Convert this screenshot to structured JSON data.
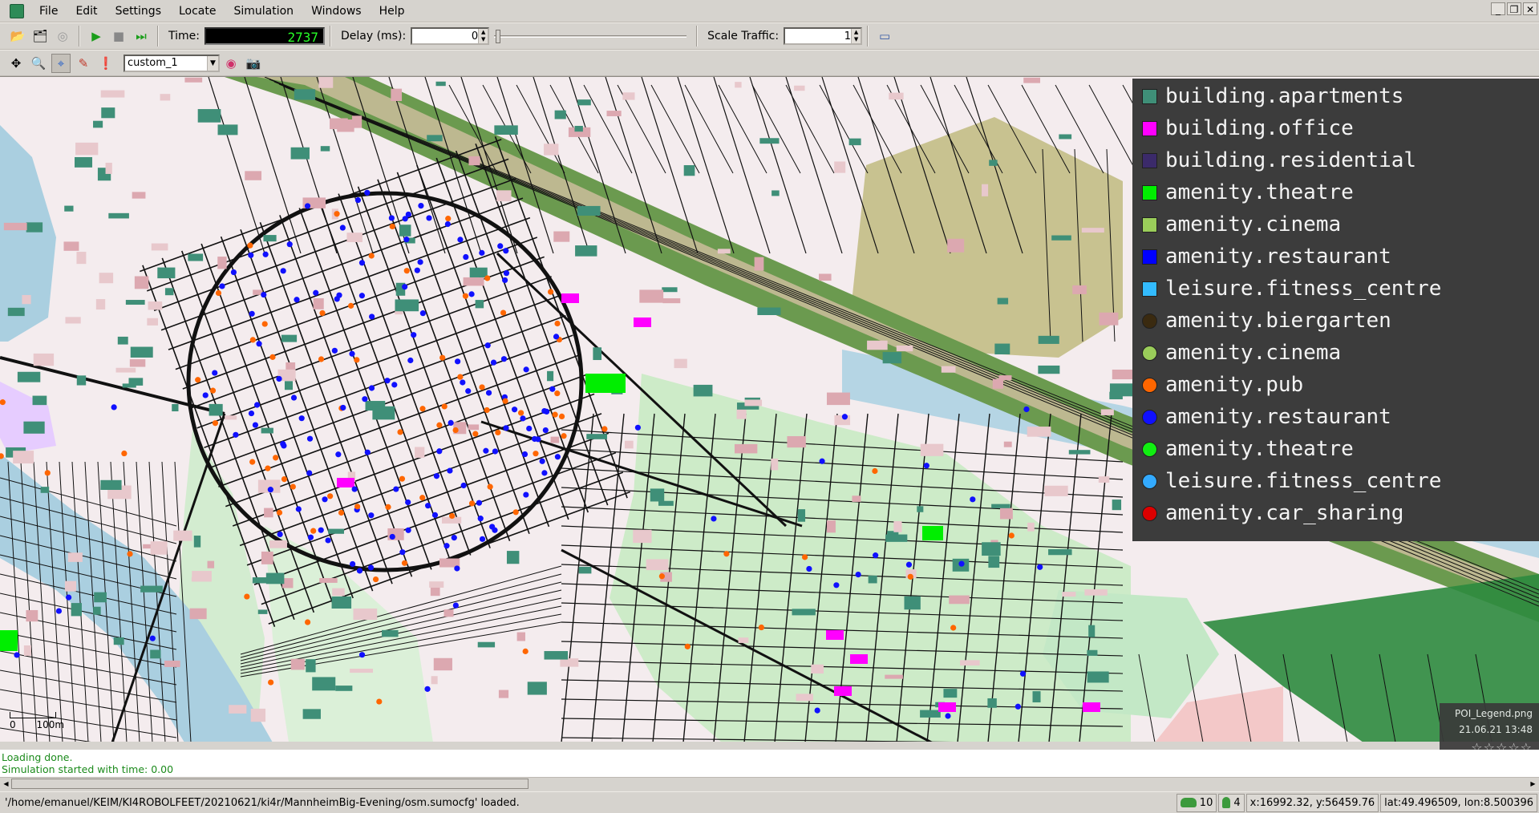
{
  "menu": {
    "items": [
      "File",
      "Edit",
      "Settings",
      "Locate",
      "Simulation",
      "Windows",
      "Help"
    ]
  },
  "window_controls": {
    "minimize": "_",
    "restore": "❐",
    "close": "✕"
  },
  "toolbar": {
    "time_label": "Time:",
    "time_value": "2737",
    "delay_label": "Delay (ms):",
    "delay_value": "0",
    "scale_label": "Scale Traffic:",
    "scale_value": "1"
  },
  "view_toolbar": {
    "scheme_value": "custom_1"
  },
  "legend": {
    "items": [
      {
        "label": "building.apartments",
        "color": "#3f8f78",
        "shape": "square"
      },
      {
        "label": "building.office",
        "color": "#ff00ff",
        "shape": "square"
      },
      {
        "label": "building.residential",
        "color": "#3b2a6a",
        "shape": "square"
      },
      {
        "label": "amenity.theatre",
        "color": "#00ee00",
        "shape": "square"
      },
      {
        "label": "amenity.cinema",
        "color": "#9acd5a",
        "shape": "square"
      },
      {
        "label": "amenity.restaurant",
        "color": "#0000ff",
        "shape": "square"
      },
      {
        "label": "leisure.fitness_centre",
        "color": "#33bbff",
        "shape": "square"
      },
      {
        "label": "amenity.biergarten",
        "color": "#3a2a10",
        "shape": "circle"
      },
      {
        "label": "amenity.cinema",
        "color": "#9acd5a",
        "shape": "circle"
      },
      {
        "label": "amenity.pub",
        "color": "#ff6600",
        "shape": "circle"
      },
      {
        "label": "amenity.restaurant",
        "color": "#1010ff",
        "shape": "circle"
      },
      {
        "label": "amenity.theatre",
        "color": "#11ee11",
        "shape": "circle"
      },
      {
        "label": "leisure.fitness_centre",
        "color": "#33aaff",
        "shape": "circle"
      },
      {
        "label": "amenity.car_sharing",
        "color": "#dd0000",
        "shape": "circle"
      }
    ]
  },
  "scale": {
    "zero": "0",
    "length": "100m"
  },
  "thumbnail": {
    "filename": "POI_Legend.png",
    "date": "21.06.21 13:48",
    "rating": "☆☆☆☆☆"
  },
  "log": {
    "lines": [
      "Loading done.",
      "Simulation started with time: 0.00"
    ]
  },
  "status": {
    "message": "'/home/emanuel/KEIM/KI4ROBOLFEET/20210621/ki4r/MannheimBig-Evening/osm.sumocfg' loaded.",
    "vehicles": "10",
    "persons": "4",
    "coords": "x:16992.32, y:56459.76",
    "latlon": "lat:49.496509, lon:8.500396"
  }
}
